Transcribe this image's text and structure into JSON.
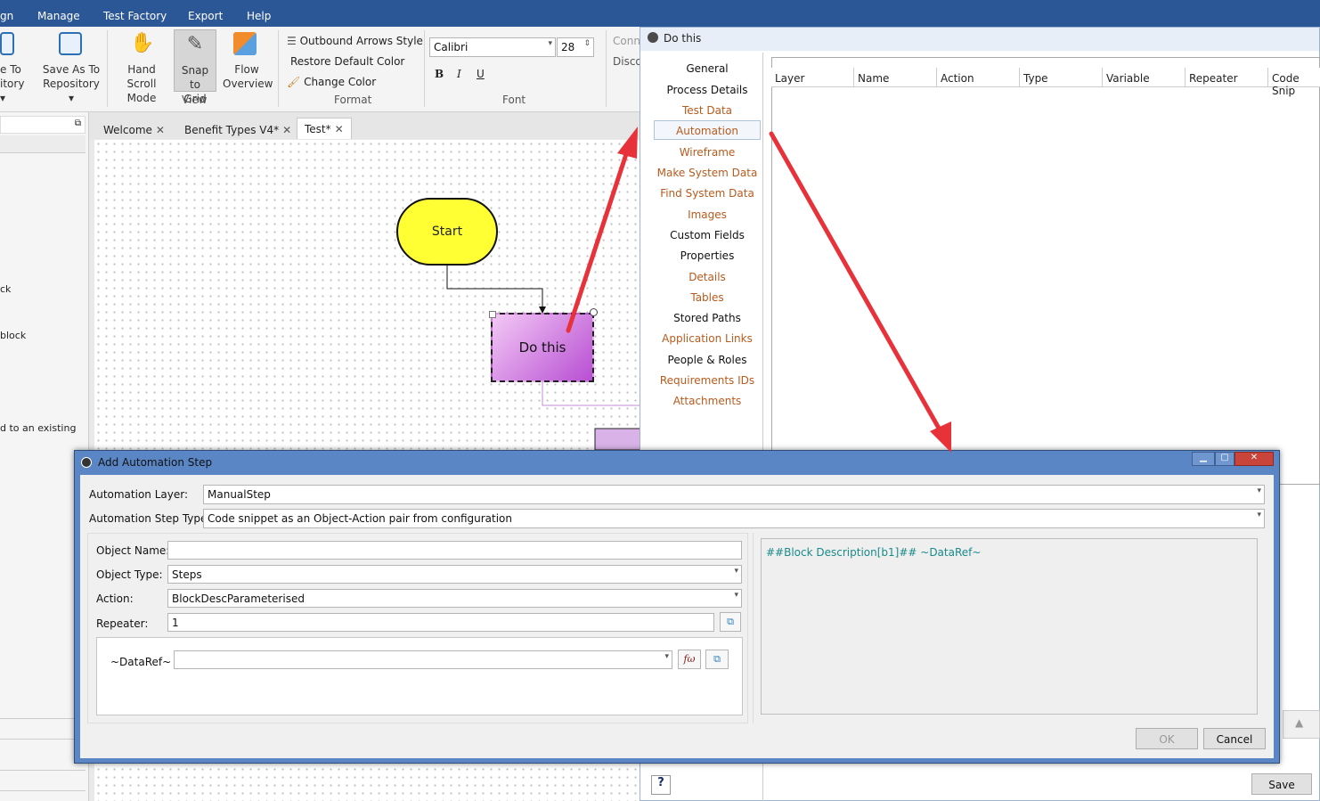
{
  "menubar": {
    "items": [
      "gn",
      "Manage",
      "Test Factory",
      "Export",
      "Help"
    ]
  },
  "ribbon": {
    "save_to_label_1": "e To",
    "save_to_label_2": "itory",
    "save_as_label_1": "Save As To",
    "save_as_label_2": "Repository",
    "hand_scroll_1": "Hand Scroll",
    "hand_scroll_2": "Mode",
    "snap_1": "Snap to",
    "snap_2": "Grid",
    "flow_1": "Flow",
    "flow_2": "Overview",
    "view_group": "View",
    "outbound_arrows": "Outbound Arrows Style",
    "restore_default": "Restore Default Color",
    "change_color": "Change Color",
    "format_group": "Format",
    "font_name": "Calibri",
    "font_size": "28",
    "bold": "B",
    "italic": "I",
    "underline": "U",
    "font_group": "Font",
    "conn_partial": "Conn",
    "disco_partial": "Disco"
  },
  "left_panel": {
    "texts": [
      "ck",
      "block",
      "d to an existing"
    ]
  },
  "tabs": [
    {
      "label": "Welcome"
    },
    {
      "label": "Benefit Types V4*"
    },
    {
      "label": "Test*"
    }
  ],
  "canvas": {
    "start_label": "Start",
    "do_label": "Do this"
  },
  "dothis_window": {
    "title": "Do this",
    "sidebar": [
      {
        "label": "General",
        "style": "plain"
      },
      {
        "label": "Process Details",
        "style": "plain"
      },
      {
        "label": "Test Data",
        "style": "link"
      },
      {
        "label": "Automation",
        "style": "link"
      },
      {
        "label": "Wireframe",
        "style": "link"
      },
      {
        "label": "Make System Data",
        "style": "link"
      },
      {
        "label": "Find System Data",
        "style": "link"
      },
      {
        "label": "Images",
        "style": "link"
      },
      {
        "label": "Custom Fields",
        "style": "plain"
      },
      {
        "label": "Properties",
        "style": "plain"
      },
      {
        "label": "Details",
        "style": "link"
      },
      {
        "label": "Tables",
        "style": "link"
      },
      {
        "label": "Stored Paths",
        "style": "plain"
      },
      {
        "label": "Application Links",
        "style": "link"
      },
      {
        "label": "People & Roles",
        "style": "plain"
      },
      {
        "label": "Requirements IDs",
        "style": "link"
      },
      {
        "label": "Attachments",
        "style": "link"
      }
    ],
    "grid_headers": [
      "Layer",
      "Name",
      "Action",
      "Type",
      "Variable",
      "Repeater",
      "Code Snip"
    ],
    "save_label": "Save"
  },
  "add_step": {
    "title": "Add Automation Step",
    "automation_layer_label": "Automation Layer:",
    "automation_layer_value": "ManualStep",
    "step_type_label": "Automation Step Type:",
    "step_type_value": "Code snippet as an Object-Action pair from configuration",
    "object_name_label": "Object Name:",
    "object_name_value": "",
    "object_type_label": "Object Type:",
    "object_type_value": "Steps",
    "action_label": "Action:",
    "action_value": "BlockDescParameterised",
    "repeater_label": "Repeater:",
    "repeater_value": "1",
    "dataref_label": "~DataRef~ :",
    "dataref_value": "",
    "fx_label": "fω",
    "preview_text": "##Block Description[b1]## ~DataRef~",
    "ok_label": "OK",
    "cancel_label": "Cancel"
  },
  "colors": {
    "menubar": "#2b5797",
    "link": "#b85a1c",
    "preview_text": "#1a8a8a",
    "arrow": "#e8323a",
    "start_fill": "#ffff33"
  }
}
